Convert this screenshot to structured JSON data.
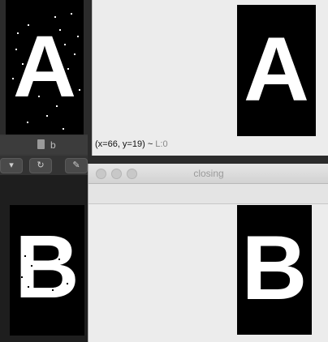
{
  "background_editor": {
    "doc_name": "b",
    "tool_icons": [
      "chevron-down-icon",
      "rotate-icon",
      "pen-icon"
    ]
  },
  "top_window": {
    "status_coords": "(x=66, y=19) ~ ",
    "status_lum": "L:0",
    "image_letter": "A"
  },
  "bottom_window": {
    "title": "closing",
    "image_letter": "B"
  },
  "noisy_panels": {
    "top_letter": "A",
    "bottom_letter": "B"
  },
  "colors": {
    "window_bg": "#ececec",
    "image_bg": "#000000",
    "glyph": "#ffffff",
    "dark_backdrop": "#2b2b2b"
  }
}
